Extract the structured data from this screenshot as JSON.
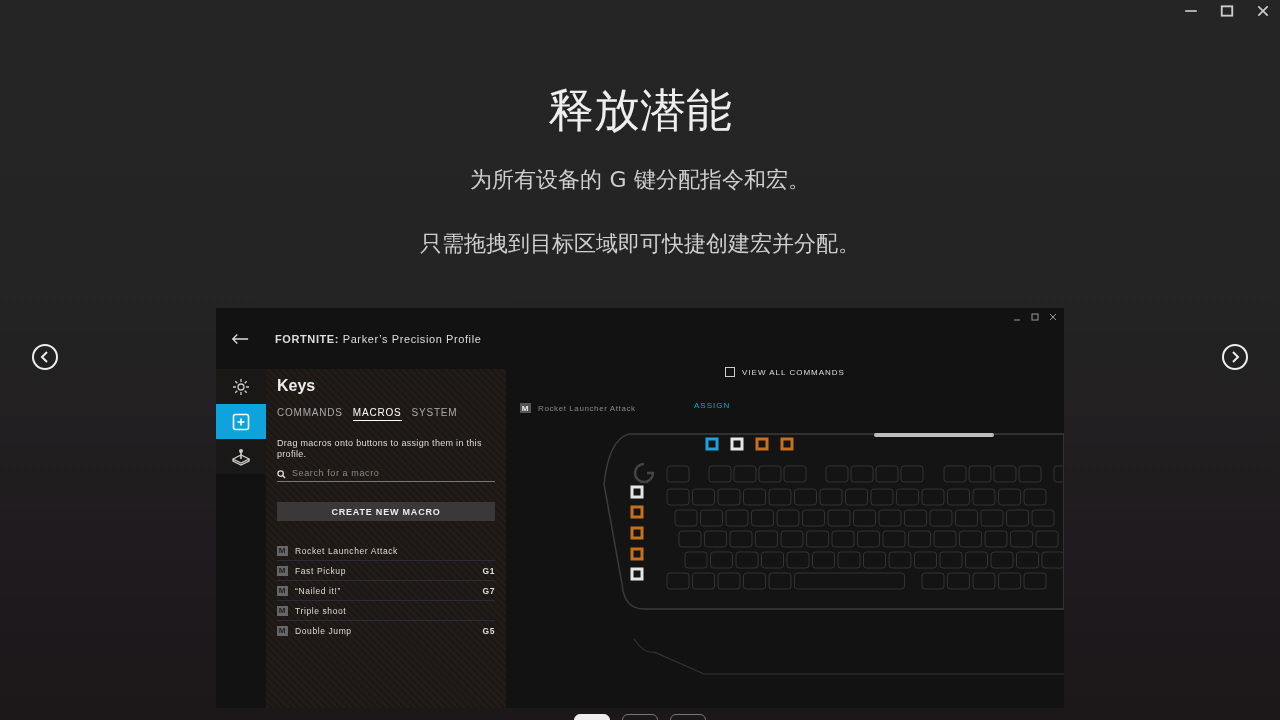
{
  "title": "释放潜能",
  "subtitles": [
    "为所有设备的 G 键分配指令和宏。",
    "只需拖拽到目标区域即可快捷创建宏并分配。"
  ],
  "carousel_pages": [
    {
      "selected": true
    },
    {
      "selected": false
    },
    {
      "selected": false
    }
  ],
  "app": {
    "game": "FORTNITE:",
    "profile": "Parker’s Precision Profile",
    "nav": [
      {
        "kind": "lighting",
        "selected": false
      },
      {
        "kind": "keys",
        "selected": true
      },
      {
        "kind": "joystick",
        "selected": false
      }
    ],
    "panel_title": "Keys",
    "tabs": [
      {
        "label": "COMMANDS",
        "selected": false
      },
      {
        "label": "MACROS",
        "selected": true
      },
      {
        "label": "SYSTEM",
        "selected": false
      }
    ],
    "hint": "Drag macros onto buttons to assign them in this profile.",
    "search_placeholder": "Search for a macro",
    "create_button": "CREATE NEW MACRO",
    "macros": [
      {
        "badge": "M",
        "name": "Rocket Launcher Attack"
      },
      {
        "badge": "M",
        "name": "Fast Pickup",
        "key": "G1"
      },
      {
        "badge": "M",
        "name": "“Nailed it!”",
        "key": "G7"
      },
      {
        "badge": "M",
        "name": "Triple shoot"
      },
      {
        "badge": "M",
        "name": "Double Jump",
        "key": "G5"
      }
    ],
    "view_all": {
      "label": "VIEW ALL COMMANDS",
      "checked": false
    },
    "dragged_macro": {
      "badge": "M",
      "name": "Rocket Launcher Attack"
    },
    "assign_label": "ASSIGN",
    "g_keys": [
      {
        "color": "#1ba3dd"
      },
      {
        "color": "#e6e6e6"
      },
      {
        "color": "#c8701e"
      },
      {
        "color": "#c8701e"
      },
      {
        "color": "#e6e6e6"
      },
      {
        "color": "#c8701e"
      },
      {
        "color": "#c8701e"
      },
      {
        "color": "#c8701e"
      },
      {
        "color": "#e6e6e6"
      }
    ]
  }
}
